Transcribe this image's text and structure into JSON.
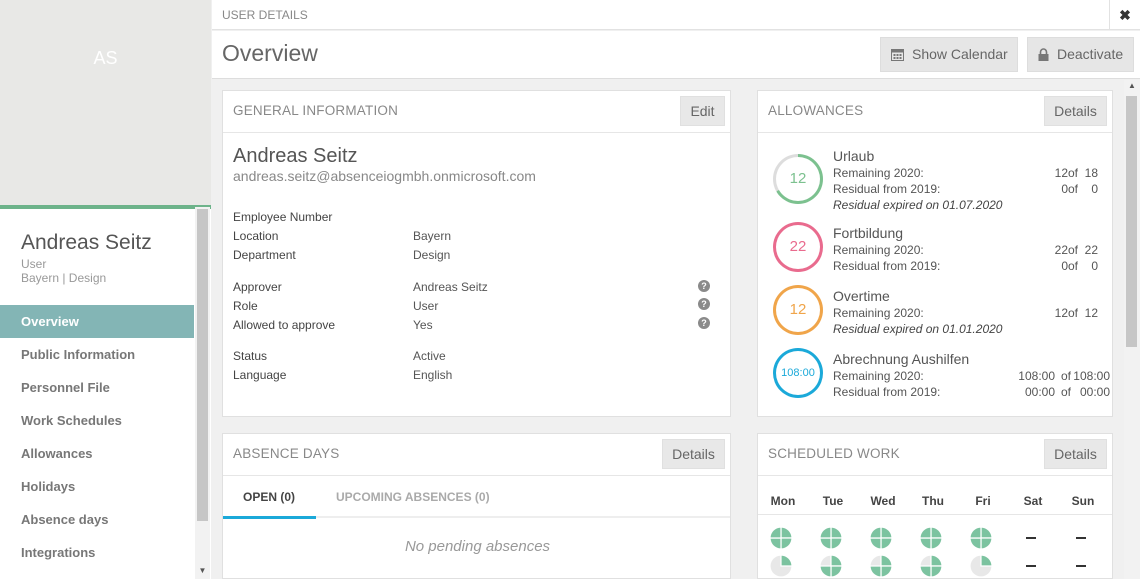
{
  "sidebar": {
    "initials": "AS",
    "name": "Andreas Seitz",
    "role": "User",
    "location": "Bayern | Design",
    "nav": [
      {
        "label": "Overview"
      },
      {
        "label": "Public Information"
      },
      {
        "label": "Personnel File"
      },
      {
        "label": "Work Schedules"
      },
      {
        "label": "Allowances"
      },
      {
        "label": "Holidays"
      },
      {
        "label": "Absence days"
      },
      {
        "label": "Integrations"
      }
    ],
    "active_index": 0
  },
  "topbar": {
    "title": "USER DETAILS",
    "close": "✖"
  },
  "header": {
    "title": "Overview",
    "show_calendar": "Show Calendar",
    "deactivate": "Deactivate"
  },
  "general": {
    "title": "GENERAL INFORMATION",
    "edit": "Edit",
    "name": "Andreas Seitz",
    "email": "andreas.seitz@absenceiogmbh.onmicrosoft.com",
    "rows": [
      {
        "label": "Employee Number",
        "value": ""
      },
      {
        "label": "Location",
        "value": "Bayern"
      },
      {
        "label": "Department",
        "value": "Design"
      },
      {
        "label": "Approver",
        "value": "Andreas Seitz"
      },
      {
        "label": "Role",
        "value": "User"
      },
      {
        "label": "Allowed to approve",
        "value": "Yes"
      },
      {
        "label": "Status",
        "value": "Active"
      },
      {
        "label": "Language",
        "value": "English"
      }
    ],
    "help_glyph": "?"
  },
  "allowances": {
    "title": "ALLOWANCES",
    "details": "Details",
    "items": [
      {
        "ring": "12",
        "color": "#7cc18f",
        "fraction": 0.667,
        "name": "Urlaub",
        "rows": [
          {
            "label": "Remaining 2020:",
            "a": "12",
            "of": "of",
            "b": "18"
          },
          {
            "label": "Residual from 2019:",
            "a": "0",
            "of": "of",
            "b": "0"
          }
        ],
        "note": "Residual expired on 01.07.2020"
      },
      {
        "ring": "22",
        "color": "#e96b8e",
        "fraction": 1.0,
        "name": "Fortbildung",
        "rows": [
          {
            "label": "Remaining 2020:",
            "a": "22",
            "of": "of",
            "b": "22"
          },
          {
            "label": "Residual from 2019:",
            "a": "0",
            "of": "of",
            "b": "0"
          }
        ],
        "note": ""
      },
      {
        "ring": "12",
        "color": "#f0a54a",
        "fraction": 1.0,
        "name": "Overtime",
        "rows": [
          {
            "label": "Remaining 2020:",
            "a": "12",
            "of": "of",
            "b": "12"
          }
        ],
        "note": "Residual expired on 01.01.2020"
      },
      {
        "ring": "108:00",
        "color": "#1ba9d9",
        "fraction": 1.0,
        "name": "Abrechnung Aushilfen",
        "rows": [
          {
            "label": "Remaining 2020:",
            "a": "108:00",
            "of": "of",
            "b": "108:00"
          },
          {
            "label": "Residual from 2019:",
            "a": "00:00",
            "of": "of",
            "b": "00:00"
          }
        ],
        "note": ""
      }
    ]
  },
  "absence": {
    "title": "ABSENCE DAYS",
    "details": "Details",
    "tab_open": "OPEN (0)",
    "tab_upcoming": "UPCOMING ABSENCES (0)",
    "empty": "No pending absences"
  },
  "scheduled": {
    "title": "SCHEDULED WORK",
    "details": "Details",
    "days": [
      "Mon",
      "Tue",
      "Wed",
      "Thu",
      "Fri",
      "Sat",
      "Sun"
    ]
  },
  "colors": {
    "accent": "#83b5b5",
    "green": "#6db38a",
    "pie": "#7cc3a0"
  }
}
